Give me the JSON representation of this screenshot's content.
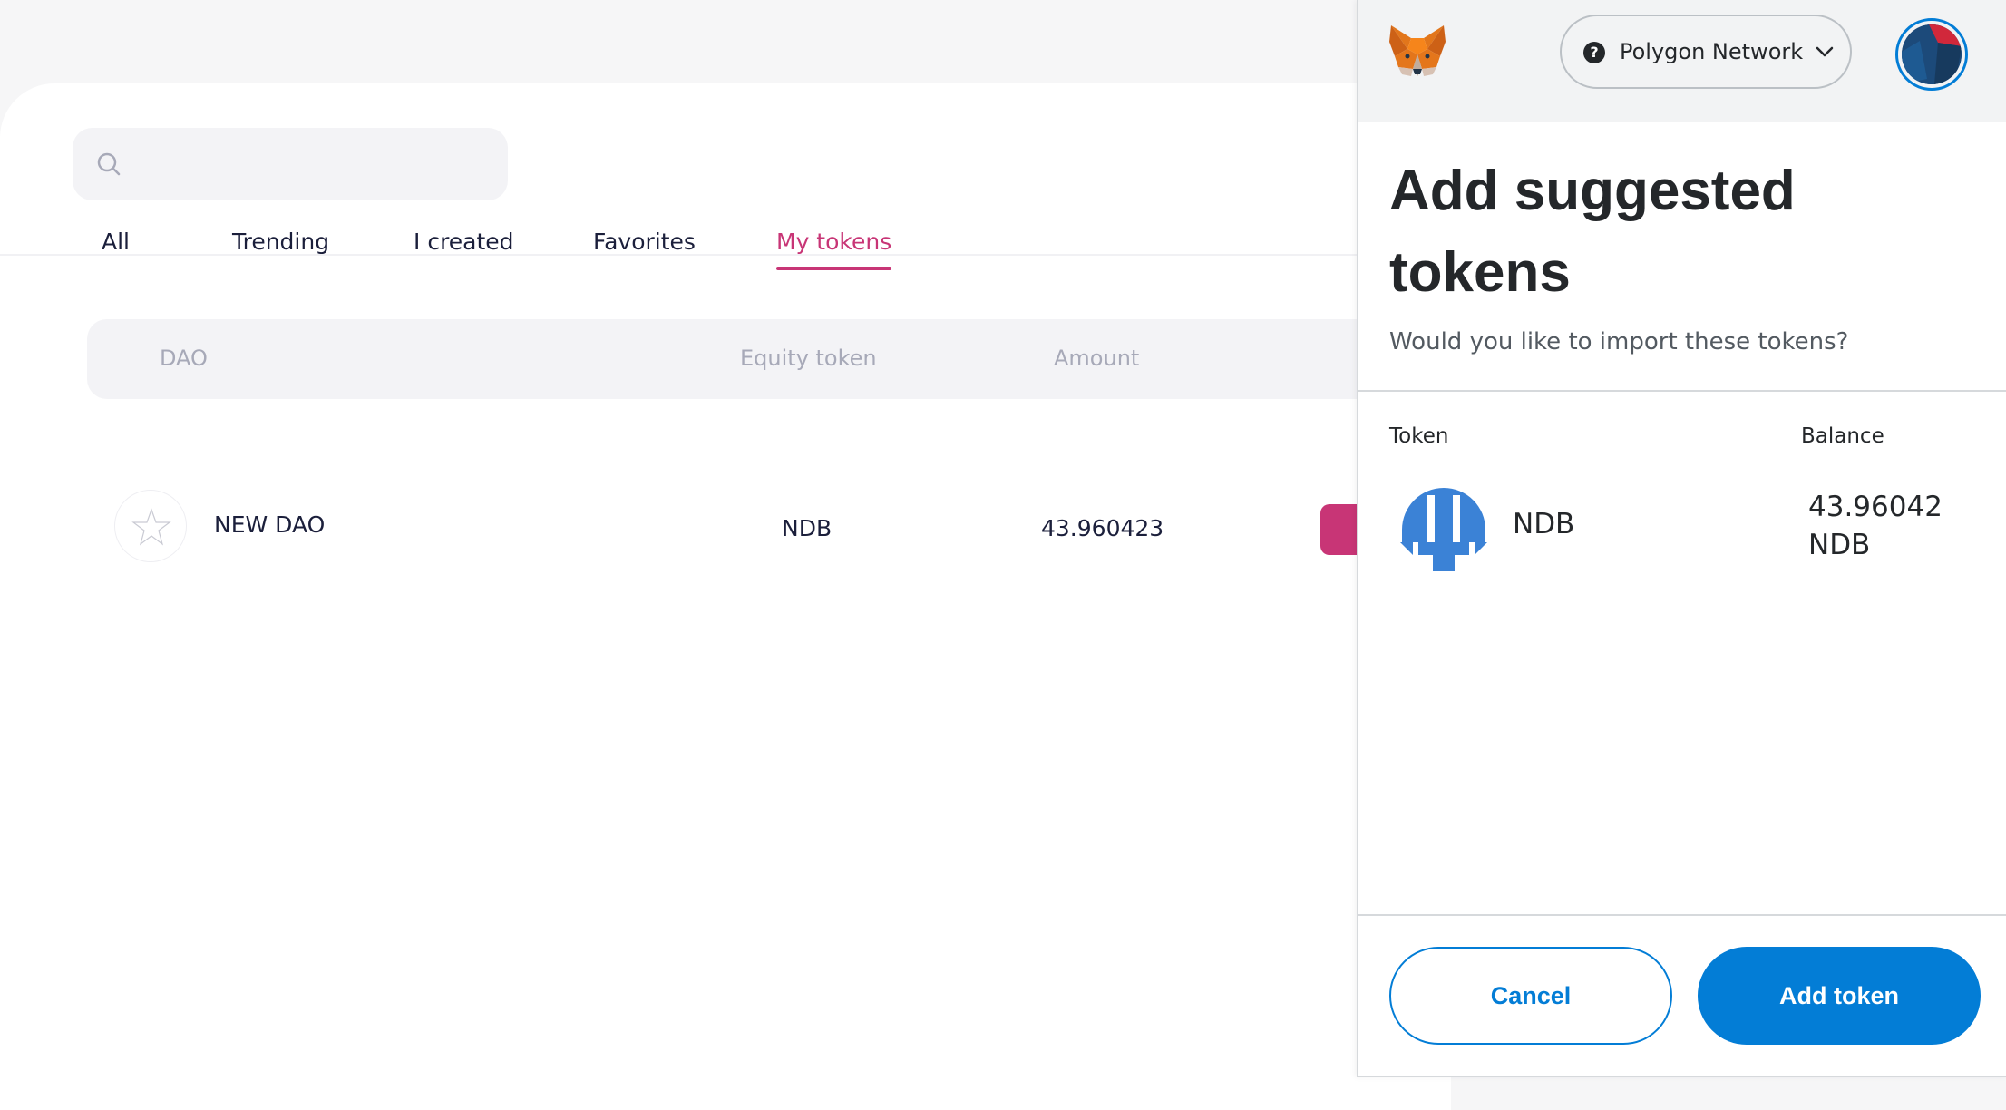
{
  "app": {
    "search": {
      "placeholder": ""
    },
    "tabs": [
      {
        "label": "All"
      },
      {
        "label": "Trending"
      },
      {
        "label": "I created"
      },
      {
        "label": "Favorites"
      },
      {
        "label": "My tokens",
        "active": true
      }
    ],
    "table": {
      "headers": {
        "dao": "DAO",
        "equity_token": "Equity token",
        "amount": "Amount"
      },
      "rows": [
        {
          "dao_name": "NEW DAO",
          "equity_token": "NDB",
          "amount": "43.960423"
        }
      ]
    },
    "accent_color": "#c83576"
  },
  "metamask": {
    "network": {
      "label": "Polygon Network",
      "icon": "question-mark"
    },
    "title": "Add suggested tokens",
    "subtitle": "Would you like to import these tokens?",
    "columns": {
      "token": "Token",
      "balance": "Balance"
    },
    "tokens": [
      {
        "symbol": "NDB",
        "balance_value": "43.96042",
        "balance_unit": "NDB"
      }
    ],
    "buttons": {
      "cancel": "Cancel",
      "add": "Add token"
    },
    "primary_color": "#037dd6"
  }
}
